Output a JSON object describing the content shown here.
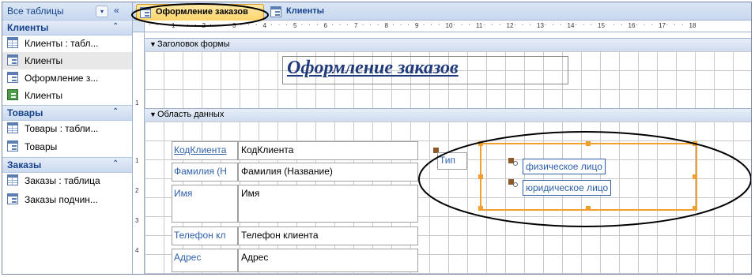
{
  "navigation": {
    "title": "Все таблицы",
    "dropdown_glyph": "▾",
    "collapse_glyph": "«",
    "groups": [
      {
        "label": "Клиенты",
        "chevron": "⌃",
        "items": [
          {
            "label": "Клиенты : табл...",
            "icon": "table-icon"
          },
          {
            "label": "Клиенты",
            "icon": "form-icon",
            "selected": true
          },
          {
            "label": "Оформление з...",
            "icon": "form-icon"
          },
          {
            "label": "Клиенты",
            "icon": "report-icon"
          }
        ]
      },
      {
        "label": "Товары",
        "chevron": "⌃",
        "items": [
          {
            "label": "Товары : табли...",
            "icon": "table-icon"
          },
          {
            "label": "Товары",
            "icon": "form-icon"
          }
        ]
      },
      {
        "label": "Заказы",
        "chevron": "⌃",
        "items": [
          {
            "label": "Заказы : таблица",
            "icon": "table-icon"
          },
          {
            "label": "Заказы подчин...",
            "icon": "form-icon"
          }
        ]
      }
    ]
  },
  "tabs": [
    {
      "label": "Оформление заказов",
      "active": true,
      "icon": "form-icon"
    },
    {
      "label": "Клиенты",
      "active": false,
      "icon": "form-icon"
    }
  ],
  "ruler": {
    "h_numbers": [
      "1",
      "2",
      "3",
      "4",
      "5",
      "6",
      "7",
      "8",
      "9",
      "10",
      "11",
      "12",
      "13",
      "14",
      "15",
      "16",
      "17",
      "18"
    ],
    "v_numbers_header": [
      "1"
    ],
    "v_numbers_detail": [
      "1",
      "2",
      "3",
      "4"
    ]
  },
  "sections": {
    "header": "Заголовок формы",
    "detail": "Область данных"
  },
  "form": {
    "title": "Оформление заказов",
    "fields": [
      {
        "label": "КодКлиента",
        "value": "КодКлиента"
      },
      {
        "label": "Фамилия (Н",
        "value": "Фамилия (Название)"
      },
      {
        "label": "Имя",
        "value": "Имя"
      },
      {
        "label": "Телефон кл",
        "value": "Телефон клиента"
      },
      {
        "label": "Адрес",
        "value": "Адрес"
      }
    ],
    "option_group": {
      "label": "Тип",
      "options": [
        "физическое лицо",
        "юридическое лицо"
      ]
    }
  },
  "colors": {
    "accent": "#f0a030",
    "label_text": "#2e5fa8",
    "title_text": "#1f3a7a",
    "nav_header": "#15428b"
  }
}
